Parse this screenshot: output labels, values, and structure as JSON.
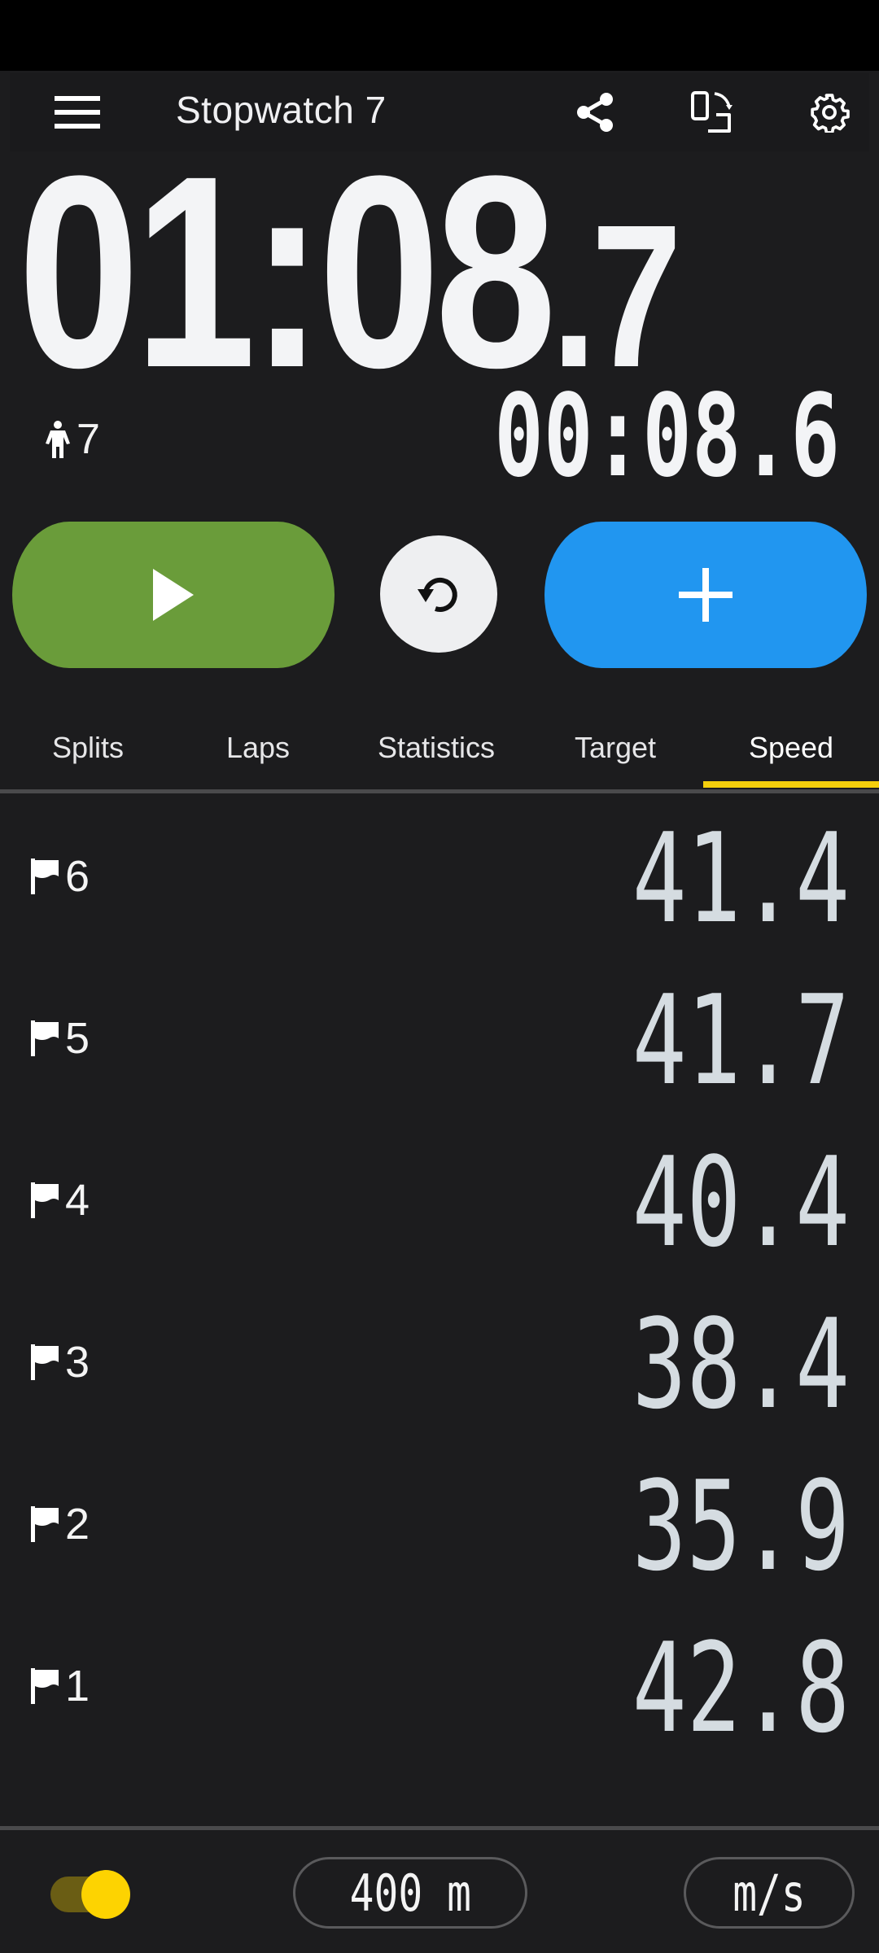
{
  "app": {
    "title": "Stopwatch 7"
  },
  "toolbar": {
    "icons": [
      "menu-icon",
      "share-icon",
      "screen-rotation-icon",
      "settings-icon"
    ]
  },
  "timer": {
    "main_time_main": "01:08",
    "main_time_tenths": ".7",
    "lap_time": "00:08.6",
    "runner_count": "7"
  },
  "controls": {
    "play_icon": "play-icon",
    "reset_icon": "reset-icon",
    "add_icon": "plus-icon",
    "colors": {
      "play": "#6a9c3a",
      "reset": "#eeeff1",
      "add": "#2196f0"
    }
  },
  "tabs": [
    {
      "label": "Splits",
      "active": false
    },
    {
      "label": "Laps",
      "active": false
    },
    {
      "label": "Statistics",
      "active": false
    },
    {
      "label": "Target",
      "active": false
    },
    {
      "label": "Speed",
      "active": true
    }
  ],
  "accent_color": "#f5cf0c",
  "speed_rows": [
    {
      "lap": "6",
      "value": "41.4"
    },
    {
      "lap": "5",
      "value": "41.7"
    },
    {
      "lap": "4",
      "value": "40.4"
    },
    {
      "lap": "3",
      "value": "38.4"
    },
    {
      "lap": "2",
      "value": "35.9"
    },
    {
      "lap": "1",
      "value": "42.8"
    }
  ],
  "footer": {
    "toggle_on": true,
    "distance": "400 m",
    "unit": "m/s"
  }
}
